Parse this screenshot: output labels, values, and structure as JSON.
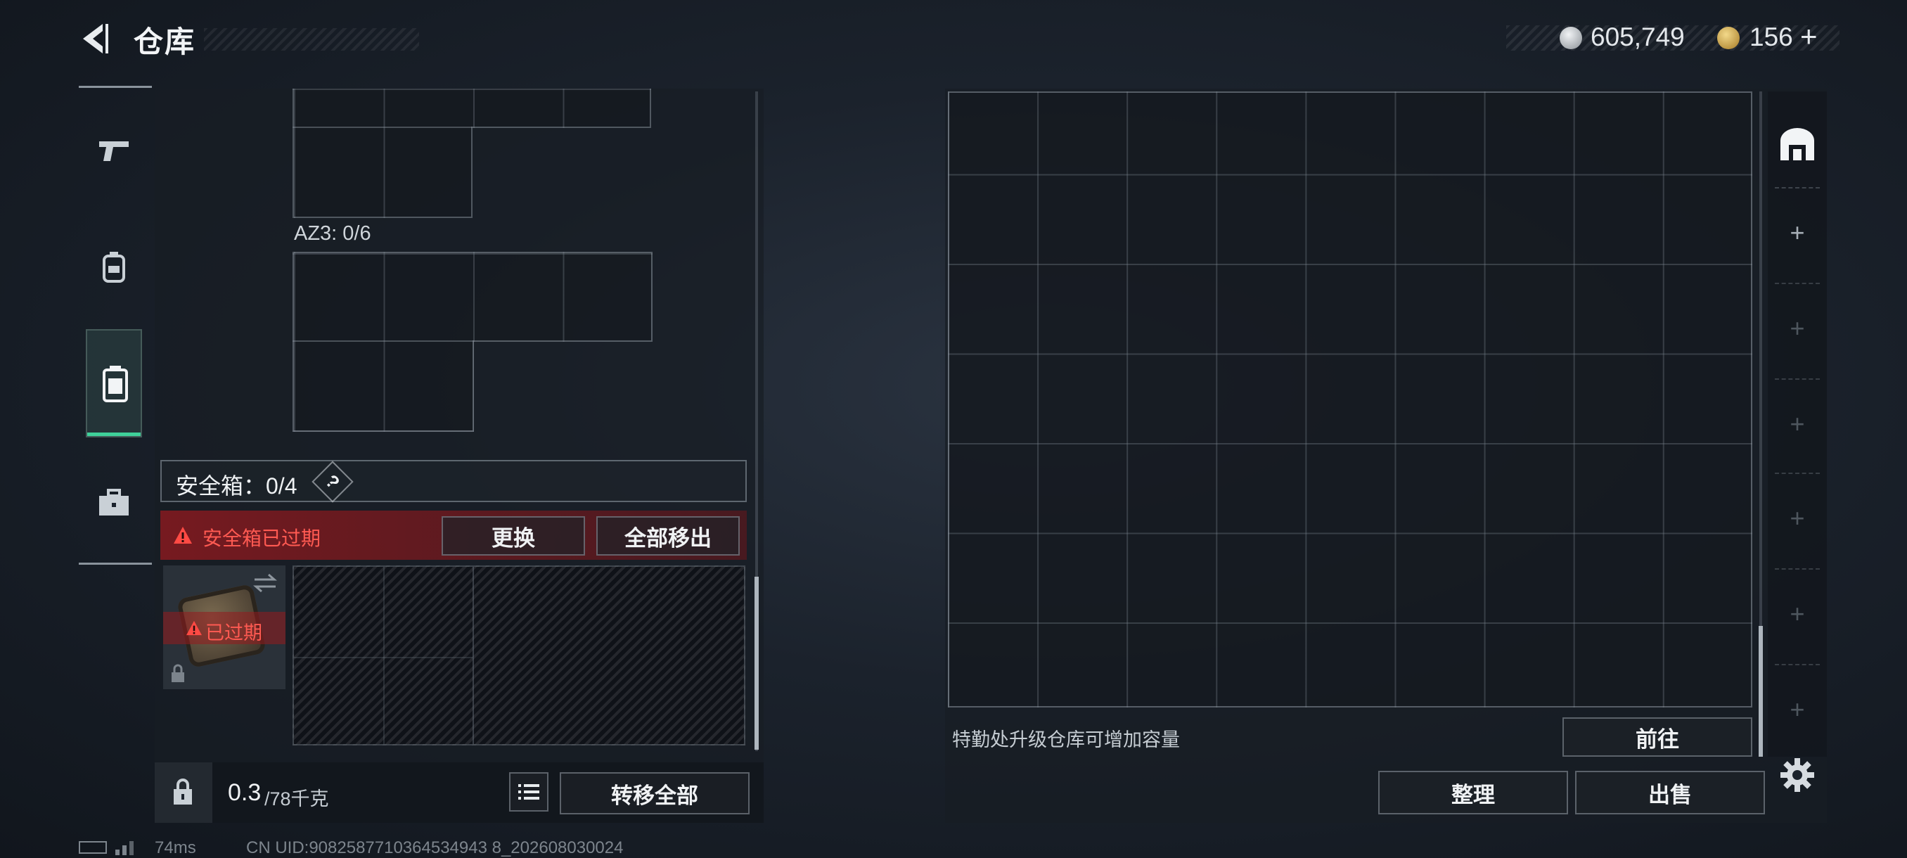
{
  "header": {
    "title": "仓库",
    "currency_silver": "605,749",
    "currency_gold": "156",
    "plus": "+"
  },
  "left_panel": {
    "az3_label": "AZ3: 0/6",
    "safebox": {
      "label": "安全箱：0/4",
      "help": "?",
      "expired_warning": "安全箱已过期",
      "replace_button": "更换",
      "remove_all_button": "全部移出",
      "item_badge": "已过期"
    },
    "weight_value": "0.3",
    "weight_capacity": "/78千克",
    "transfer_all_button": "转移全部"
  },
  "right_panel": {
    "upgrade_hint": "特勤处升级仓库可增加容量",
    "goto_button": "前往",
    "sort_button": "整理",
    "sell_button": "出售",
    "tab_plus": "+"
  },
  "status_bar": {
    "ping": "74ms",
    "uid": "CN UID:9082587710364534943 8_202608030024"
  },
  "colors": {
    "accent_green": "#3fd19a",
    "warning_red": "#e0413d",
    "panel_bg": "#1c2128"
  }
}
